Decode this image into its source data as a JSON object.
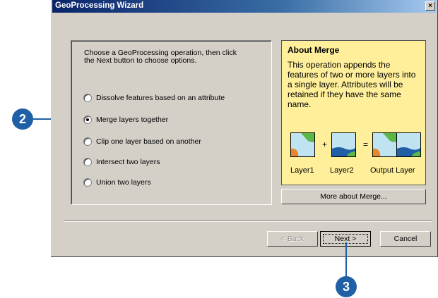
{
  "window": {
    "title": "GeoProcessing Wizard",
    "close_glyph": "×"
  },
  "instructions": "Choose a GeoProcessing operation, then click the Next button to choose options.",
  "operations": [
    {
      "label": "Dissolve features based on an attribute",
      "selected": false
    },
    {
      "label": "Merge layers together",
      "selected": true
    },
    {
      "label": "Clip one layer based on another",
      "selected": false
    },
    {
      "label": "Intersect two layers",
      "selected": false
    },
    {
      "label": "Union two layers",
      "selected": false
    }
  ],
  "about": {
    "title": "About Merge",
    "body": "This operation appends the features of two or more layers into a single layer.  Attributes will be retained if they have the same name.",
    "plus": "+",
    "equals": "=",
    "labels": [
      "Layer1",
      "Layer2",
      "Output Layer"
    ]
  },
  "more_button": "More about Merge...",
  "buttons": {
    "back": "< Back",
    "next": "Next >",
    "cancel": "Cancel"
  },
  "callouts": [
    "2",
    "3"
  ],
  "colors": {
    "callout": "#1f5fa6",
    "info_box": "#ffef9b",
    "map_green": "#5bb848",
    "map_blue": "#1f5fa6",
    "map_orange": "#e8862a",
    "map_light": "#bfe3f0"
  }
}
